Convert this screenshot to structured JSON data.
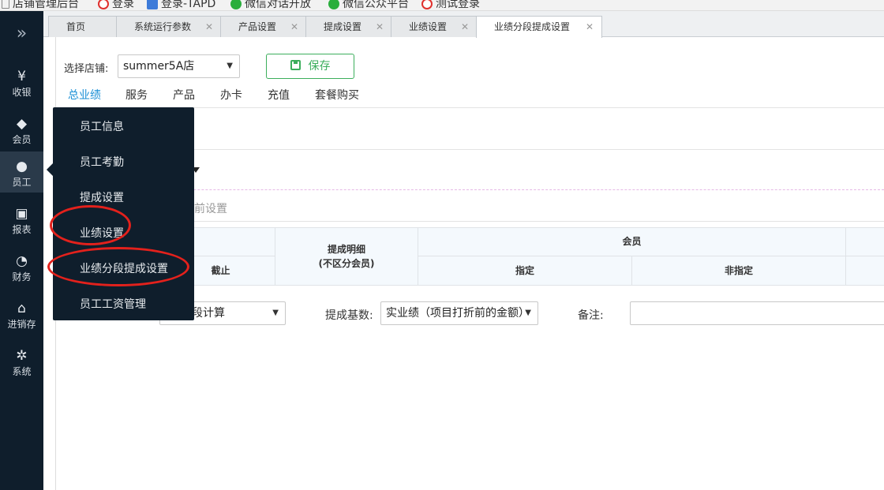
{
  "bookmarks": [
    {
      "label": "店铺管理后台",
      "icon": "page-icon"
    },
    {
      "label": "登录",
      "icon": "red-logo-icon"
    },
    {
      "label": "登录-TAPD",
      "icon": "tapd-icon"
    },
    {
      "label": "微信对话开放",
      "icon": "wechat-icon"
    },
    {
      "label": "微信公众平台",
      "icon": "wechat-icon"
    },
    {
      "label": "测试登录",
      "icon": "red-logo-icon"
    }
  ],
  "sidebar": {
    "toggle": "»",
    "items": [
      {
        "label": "收银",
        "icon": "¥"
      },
      {
        "label": "会员",
        "icon": "◆"
      },
      {
        "label": "员工",
        "icon": "●"
      },
      {
        "label": "报表",
        "icon": "▣"
      },
      {
        "label": "财务",
        "icon": "◔"
      },
      {
        "label": "进销存",
        "icon": "⌂"
      },
      {
        "label": "系统",
        "icon": "✲"
      }
    ],
    "active_index": 2
  },
  "tabs": [
    {
      "label": "首页",
      "closable": false
    },
    {
      "label": "系统运行参数",
      "closable": true
    },
    {
      "label": "产品设置",
      "closable": true
    },
    {
      "label": "提成设置",
      "closable": true
    },
    {
      "label": "业绩设置",
      "closable": true
    },
    {
      "label": "业绩分段提成设置",
      "closable": true,
      "active": true
    }
  ],
  "toolbar": {
    "store_label": "选择店铺:",
    "store_value": "summer5A店",
    "save_label": "保存"
  },
  "subtabs": [
    "总业绩",
    "服务",
    "产品",
    "办卡",
    "充值",
    "套餐购买"
  ],
  "current_setting": "当前设置",
  "table_header": {
    "col_deadline": "截止",
    "col_detail": "提成明细",
    "col_detail_sub": "(不区分会员)",
    "col_member": "会员",
    "col_specified": "指定",
    "col_unspecified": "非指定"
  },
  "form": {
    "calc_value": "段计算",
    "base_label": "提成基数:",
    "base_value": "实业绩（项目打折前的金额）",
    "remark_label": "备注:"
  },
  "menu": {
    "items": [
      "员工信息",
      "员工考勤",
      "提成设置",
      "业绩设置",
      "业绩分段提成设置",
      "员工工资管理"
    ]
  },
  "colors": {
    "sidebar_bg": "#0f1e2c",
    "accent": "#1a8fd6",
    "save_green": "#3cae5c",
    "annotation_red": "#e3211c"
  }
}
